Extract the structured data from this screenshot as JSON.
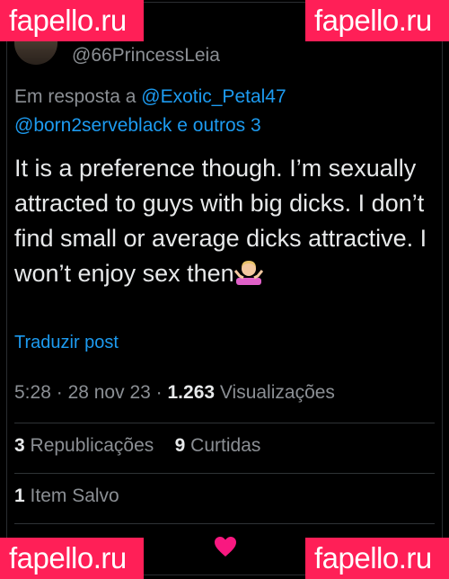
{
  "watermark": {
    "text": "fapello.ru",
    "color": "#ff1f57"
  },
  "author": {
    "handle": "@66PrincessLeia"
  },
  "reply": {
    "prefix": "Em resposta a",
    "mention1": "@Exotic_Petal47",
    "mention2": "@born2serveblack",
    "suffix": "e outros 3"
  },
  "tweet": {
    "text": "It is a preference though. I’m sexually attracted to guys with big dicks. I don’t find small or average dicks attractive. I won’t enjoy sex then",
    "emoji": "person-shrugging-emoji"
  },
  "translate_label": "Traduzir post",
  "meta": {
    "time": "5:28",
    "sep": "·",
    "date": "28 nov 23",
    "views_count": "1.263",
    "views_label": "Visualizações"
  },
  "stats": {
    "reposts_count": "3",
    "reposts_label": "Republicações",
    "likes_count": "9",
    "likes_label": "Curtidas"
  },
  "saved": {
    "count": "1",
    "label": "Item Salvo"
  },
  "colors": {
    "accent": "#1d9bf0",
    "secondary": "#8b8f94",
    "heart": "#f91880"
  }
}
